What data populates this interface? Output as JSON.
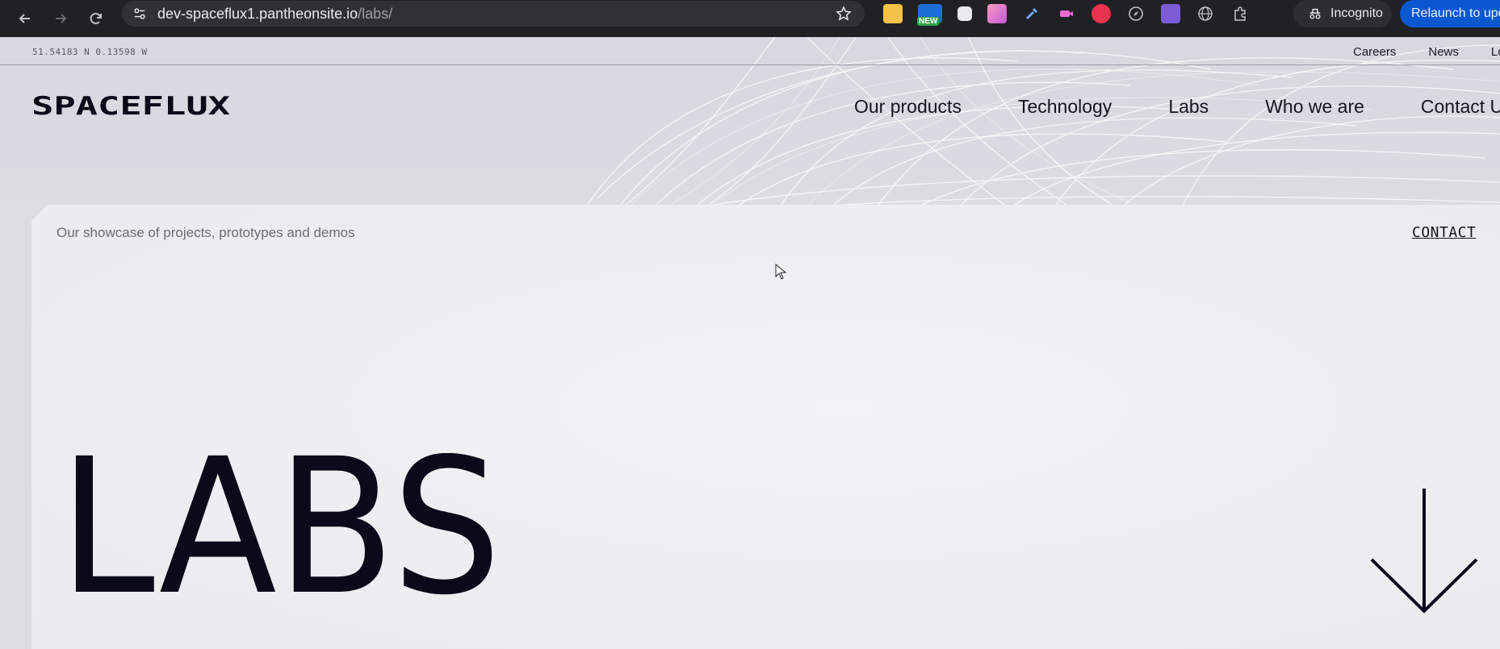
{
  "browser": {
    "url_host": "dev-spaceflux1.pantheonsite.io",
    "url_path": "/labs/",
    "incognito_label": "Incognito",
    "relaunch_label": "Relaunch to update",
    "ext_new_badge": "NEW"
  },
  "top_strip": {
    "coordinates": "51.54183 N 0.13598 W",
    "links": [
      "Careers",
      "News",
      "Login"
    ]
  },
  "header": {
    "logo_text": "SPACEFLUX",
    "nav": [
      "Our products",
      "Technology",
      "Labs",
      "Who we are",
      "Contact Us"
    ]
  },
  "hero": {
    "subtitle": "Our showcase of projects, prototypes and demos",
    "contact_label": "CONTACT",
    "title": "LABS"
  },
  "colors": {
    "text_dark": "#0b0a1a",
    "browser_bg": "#202124",
    "relaunch_blue": "#0b57d0"
  }
}
